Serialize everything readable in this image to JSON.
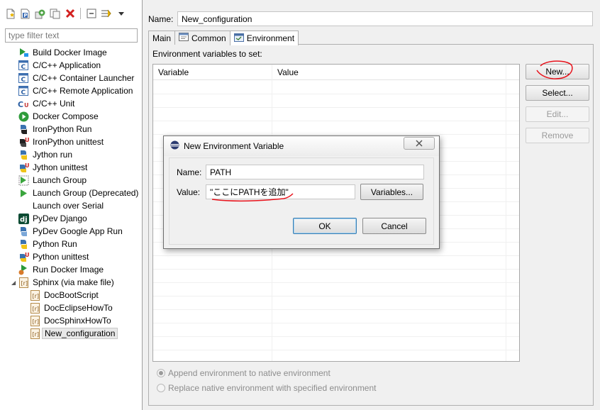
{
  "left": {
    "filter_placeholder": "type filter text",
    "toolbar_icons": [
      "new-launch-config-icon",
      "new-prototype-icon",
      "export-icon",
      "duplicate-icon",
      "delete-icon",
      "collapse-all-icon",
      "filter-icon",
      "view-menu-icon"
    ],
    "tree": [
      {
        "label": "Build Docker Image",
        "icon": "docker-build-icon"
      },
      {
        "label": "C/C++ Application",
        "icon": "c-app-icon"
      },
      {
        "label": "C/C++ Container Launcher",
        "icon": "c-app-icon"
      },
      {
        "label": "C/C++ Remote Application",
        "icon": "c-app-icon"
      },
      {
        "label": "C/C++ Unit",
        "icon": "c-unit-icon"
      },
      {
        "label": "Docker Compose",
        "icon": "docker-compose-icon"
      },
      {
        "label": "IronPython Run",
        "icon": "python-run-icon"
      },
      {
        "label": "IronPython unittest",
        "icon": "python-unittest-icon"
      },
      {
        "label": "Jython run",
        "icon": "python-run-icon"
      },
      {
        "label": "Jython unittest",
        "icon": "python-unittest-icon"
      },
      {
        "label": "Launch Group",
        "icon": "launch-group-icon"
      },
      {
        "label": "Launch Group (Deprecated)",
        "icon": "launch-group-icon"
      },
      {
        "label": "Launch over Serial",
        "icon": "blank-icon"
      },
      {
        "label": "PyDev Django",
        "icon": "django-icon"
      },
      {
        "label": "PyDev Google App Run",
        "icon": "google-app-icon"
      },
      {
        "label": "Python Run",
        "icon": "python-run-icon"
      },
      {
        "label": "Python unittest",
        "icon": "python-unittest-icon"
      },
      {
        "label": "Run Docker Image",
        "icon": "docker-run-icon"
      },
      {
        "label": "Sphinx (via make file)",
        "icon": "sphinx-icon"
      },
      {
        "label": "DocBootScript",
        "icon": "sphinx-icon"
      },
      {
        "label": "DocEclipseHowTo",
        "icon": "sphinx-icon"
      },
      {
        "label": "DocSphinxHowTo",
        "icon": "sphinx-icon"
      },
      {
        "label": "New_configuration",
        "icon": "sphinx-icon"
      }
    ]
  },
  "right": {
    "name_label": "Name:",
    "name_value": "New_configuration",
    "tabs": [
      {
        "label": "Main",
        "icon": ""
      },
      {
        "label": "Common",
        "icon": "common-tab-icon"
      },
      {
        "label": "Environment",
        "icon": "environment-tab-icon"
      }
    ],
    "env_label": "Environment variables to set:",
    "table_headers": [
      "Variable",
      "Value"
    ],
    "buttons": {
      "new": "New...",
      "select": "Select...",
      "edit": "Edit...",
      "remove": "Remove"
    },
    "radio_append": "Append environment to native environment",
    "radio_replace": "Replace native environment with specified environment"
  },
  "dialog": {
    "title": "New Environment Variable",
    "name_label": "Name:",
    "name_value": "PATH",
    "value_label": "Value:",
    "value_value": "\"ここにPATHを追加\"",
    "variables_button": "Variables...",
    "ok_button": "OK",
    "cancel_button": "Cancel"
  },
  "colors": {
    "annotation": "#e8121b",
    "eclipse_blue": "#2b4d8c"
  }
}
